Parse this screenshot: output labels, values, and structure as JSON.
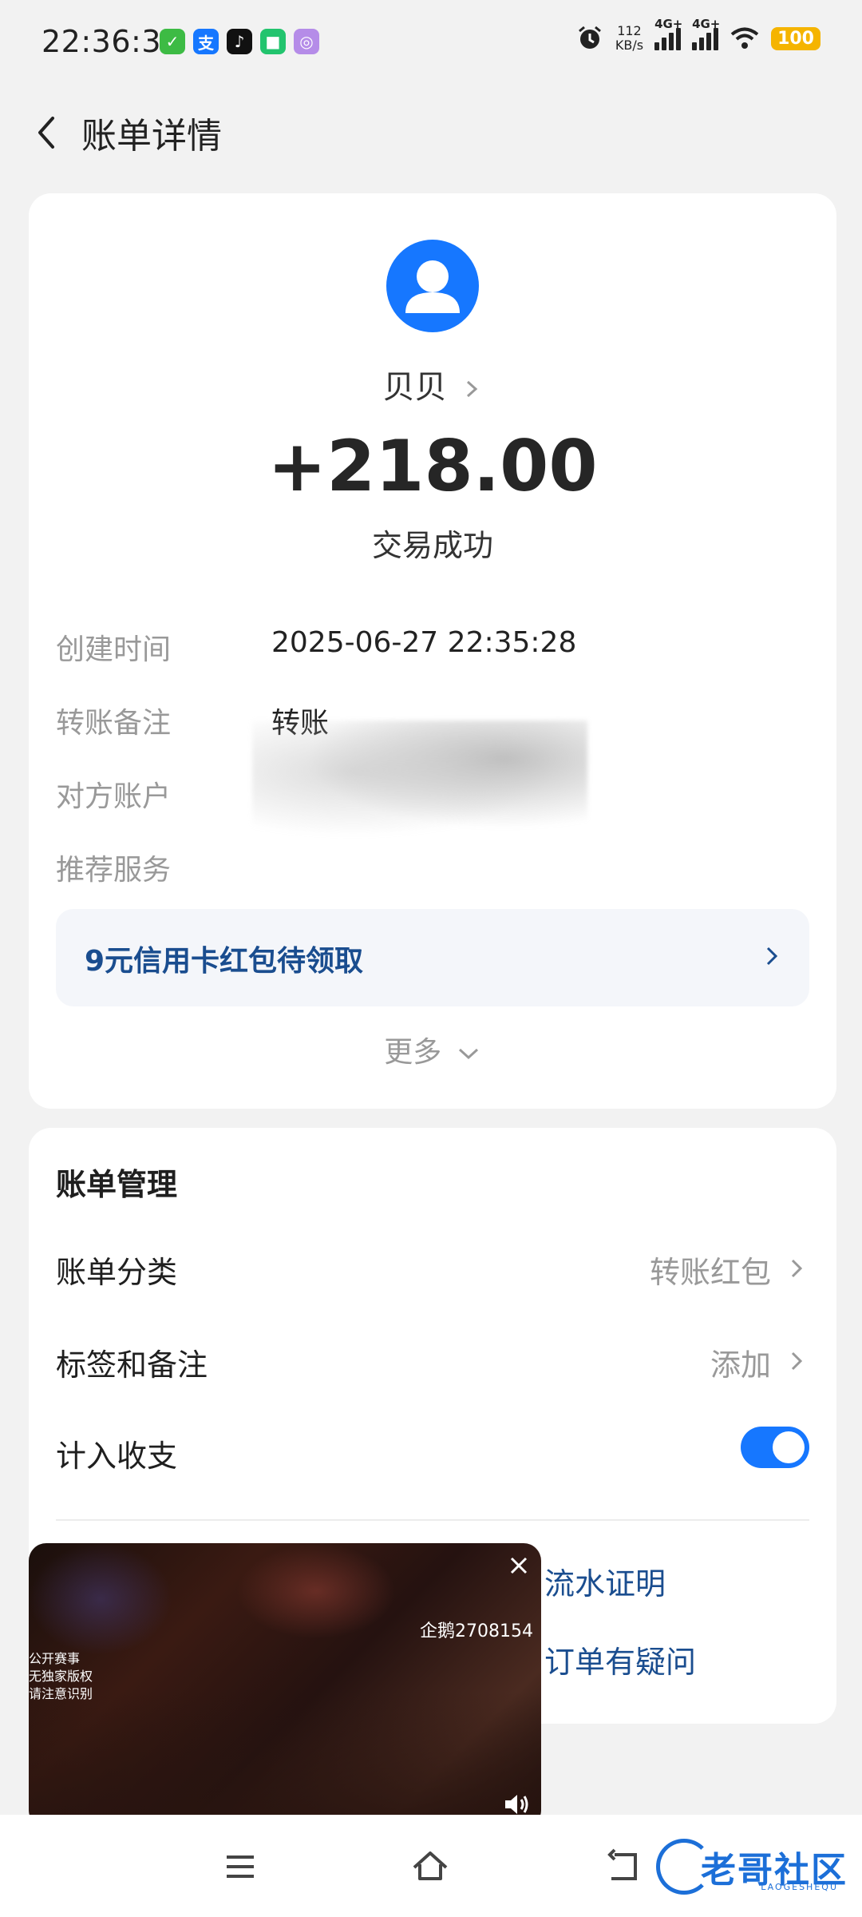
{
  "status_bar": {
    "time": "22:36:31",
    "network_speed_value": "112",
    "network_speed_unit": "KB/s",
    "signal1_label": "4G+",
    "signal2_label": "4G+",
    "battery": "100"
  },
  "header": {
    "title": "账单详情"
  },
  "bill": {
    "payer_name": "贝贝",
    "amount": "+218.00",
    "status": "交易成功",
    "fields": [
      {
        "key": "创建时间",
        "value": "2025-06-27 22:35:28"
      },
      {
        "key": "转账备注",
        "value": "转账"
      },
      {
        "key": "对方账户",
        "value": ""
      },
      {
        "key": "推荐服务",
        "value": ""
      }
    ],
    "promo": "9元信用卡红包待领取",
    "more": "更多"
  },
  "management": {
    "title": "账单管理",
    "category_label": "账单分类",
    "category_value": "转账红包",
    "tag_label": "标签和备注",
    "tag_value": "添加",
    "include_label": "计入收支",
    "include_on": true,
    "link1": "流水证明",
    "link2": "订单有疑问"
  },
  "video_overlay": {
    "notice": [
      "公开赛事",
      "无独家版权",
      "请注意识别"
    ],
    "qq": "企鹅2708154"
  },
  "watermark": {
    "text": "老哥社区",
    "sub": "LAOGESHEQU"
  },
  "colors": {
    "accent": "#1677ff",
    "link": "#1a4d8f",
    "battery": "#f5b400"
  }
}
